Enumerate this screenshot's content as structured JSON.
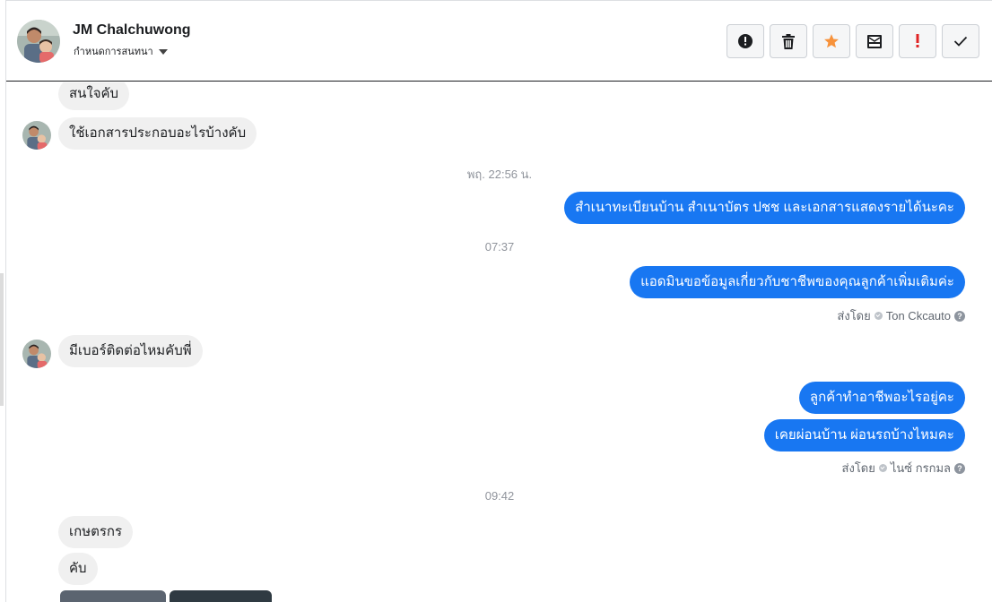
{
  "header": {
    "contact_name": "JM Chalchuwong",
    "assign_label": "กำหนดการสนทนา",
    "actions": [
      {
        "name": "report-spam-button",
        "icon": "exclamation-circle-icon"
      },
      {
        "name": "delete-button",
        "icon": "trash-icon"
      },
      {
        "name": "star-button",
        "icon": "star-icon",
        "color": "#f7923b"
      },
      {
        "name": "archive-button",
        "icon": "archive-icon"
      },
      {
        "name": "mark-important-button",
        "icon": "exclamation-icon",
        "color": "#e02424"
      },
      {
        "name": "mark-done-button",
        "icon": "checkmark-icon"
      }
    ]
  },
  "thread": {
    "msg1": "สนใจคับ",
    "msg2": "ใช้เอกสารประกอบอะไรบ้างคับ",
    "time1": "พฤ. 22:56 น.",
    "msg3": "สำเนาทะเบียนบ้าน สำเนาบัตร ปชช และเอกสารแสดงรายได้นะคะ",
    "time2": "07:37",
    "msg4": "แอดมินขอข้อมูลเกี่ยวกับชาชีพของคุณลูกค้าเพิ่มเติมค่ะ",
    "sent_by1_label": "ส่งโดย",
    "sent_by1_name": "Ton Ckcauto",
    "msg5": "มีเบอร์ติดต่อไหมคับพี่",
    "msg6": "ลูกค้าทำอาชีพอะไรอยู่คะ",
    "msg7": "เคยผ่อนบ้าน ผ่อนรถบ้างไหมคะ",
    "sent_by2_label": "ส่งโดย",
    "sent_by2_name": "ไนซ์ กรกมล",
    "time3": "09:42",
    "msg8": "เกษตรกร",
    "msg9": "คับ"
  },
  "colors": {
    "outgoing_bubble": "#1877f2",
    "incoming_bubble": "#f0f0f0",
    "star": "#f7923b",
    "important": "#e02424"
  }
}
